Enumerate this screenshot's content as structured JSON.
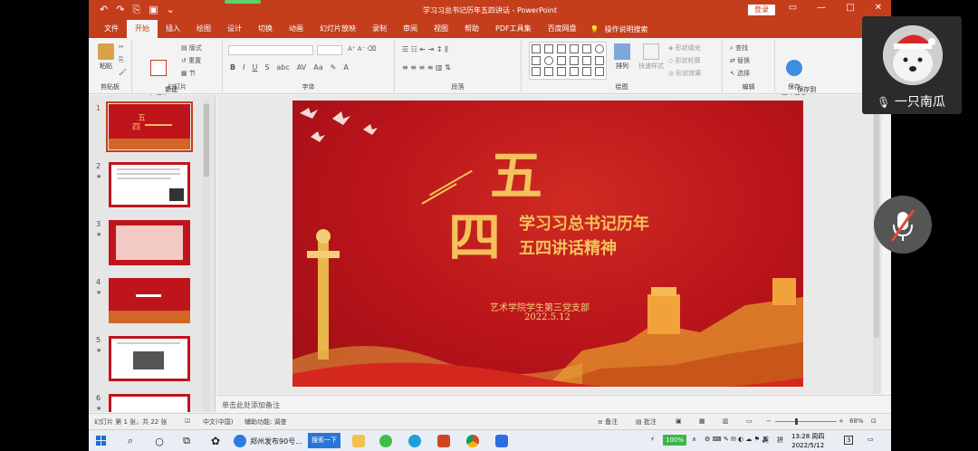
{
  "window": {
    "title": "学习习总书记历年五四讲话 - PowerPoint",
    "login_label": "登录"
  },
  "ribbon_tabs": [
    "文件",
    "开始",
    "插入",
    "绘图",
    "设计",
    "切换",
    "动画",
    "幻灯片放映",
    "录制",
    "审阅",
    "视图",
    "帮助",
    "PDF工具集",
    "百度网盘"
  ],
  "ribbon_help": "操作说明搜索",
  "ribbon": {
    "clipboard": {
      "paste": "粘贴",
      "group": "剪贴板"
    },
    "slides": {
      "new_slide": "新建\n幻灯片",
      "layout": "版式",
      "reset": "重置",
      "section": "节",
      "group": "幻灯片"
    },
    "font": {
      "group": "字体"
    },
    "paragraph": {
      "group": "段落"
    },
    "drawing": {
      "arrange": "排列",
      "quick_styles": "快速样式",
      "shape_fill": "形状填充",
      "shape_outline": "形状轮廓",
      "shape_effects": "形状效果",
      "group": "绘图"
    },
    "editing": {
      "find": "查找",
      "replace": "替换",
      "select": "选择",
      "group": "编辑"
    },
    "save": {
      "save_baidu": "保存到\n百度网盘",
      "group": "保存"
    }
  },
  "thumbnails": [
    {
      "num": "1"
    },
    {
      "num": "2"
    },
    {
      "num": "3"
    },
    {
      "num": "4"
    },
    {
      "num": "5"
    },
    {
      "num": "6"
    }
  ],
  "slide": {
    "char_five": "五",
    "char_four": "四",
    "line1": "学习习总书记历年",
    "line2": "五四讲话精神",
    "org": "艺术学院学生第三党支部",
    "date": "2022.5.12"
  },
  "notes_placeholder": "单击此处添加备注",
  "status": {
    "slide_info": "幻灯片 第 1 张，共 22 张",
    "lang": "中文(中国)",
    "accessibility": "辅助功能: 调查",
    "notes": "备注",
    "comments": "批注",
    "zoom": "68%"
  },
  "taskbar": {
    "app1": "郑州发布90号...",
    "search": "搜索一下",
    "battery": "100%",
    "ime_lang": "英",
    "ime_mode": "拼",
    "time": "13:28 周四",
    "date": "2022/5/12",
    "notif": "3"
  },
  "overlay": {
    "participant_name": "一只南瓜"
  },
  "colors": {
    "ppt_red": "#c43e1c",
    "slide_red": "#b8141a",
    "gold": "#f3c25a"
  }
}
